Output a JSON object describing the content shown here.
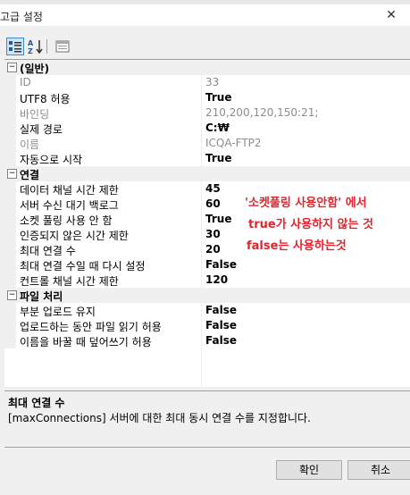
{
  "window": {
    "title": "고급 설정",
    "close_glyph": "✕"
  },
  "toolbar": {
    "categorized_icon": "categorized-view-icon",
    "alphabetical_icon": "alphabetical-sort-icon",
    "property_pages_icon": "property-pages-icon"
  },
  "grid": {
    "categories": [
      {
        "label": "(일반)",
        "toggle": "⊟",
        "properties": [
          {
            "name": "ID",
            "value": "33",
            "readonly": true
          },
          {
            "name": "UTF8 허용",
            "value": "True",
            "readonly": false
          },
          {
            "name": "바인딩",
            "value": "210,200,120,150:21;",
            "readonly": true
          },
          {
            "name": "실제 경로",
            "value": "C:₩",
            "readonly": false
          },
          {
            "name": "이름",
            "value": "ICQA-FTP2",
            "readonly": true
          },
          {
            "name": "자동으로 시작",
            "value": "True",
            "readonly": false
          }
        ]
      },
      {
        "label": "연결",
        "toggle": "⊟",
        "properties": [
          {
            "name": "데이터 채널 시간 제한",
            "value": "45",
            "readonly": false
          },
          {
            "name": "서버 수신 대기 백로그",
            "value": "60",
            "readonly": false
          },
          {
            "name": "소켓 풀링 사용 안 함",
            "value": "True",
            "readonly": false
          },
          {
            "name": "인증되지 않은 시간 제한",
            "value": "30",
            "readonly": false
          },
          {
            "name": "최대 연결 수",
            "value": "20",
            "readonly": false
          },
          {
            "name": "최대 연결 수일 때 다시 설정",
            "value": "False",
            "readonly": false
          },
          {
            "name": "컨트롤 채널 시간 제한",
            "value": "120",
            "readonly": false
          }
        ]
      },
      {
        "label": "파일 처리",
        "toggle": "⊟",
        "properties": [
          {
            "name": "부분 업로드 유지",
            "value": "False",
            "readonly": false
          },
          {
            "name": "업로드하는 동안 파일 읽기 허용",
            "value": "False",
            "readonly": false
          },
          {
            "name": "이름을 바꿀 때 덮어쓰기 허용",
            "value": "False",
            "readonly": false
          }
        ]
      }
    ]
  },
  "annotation": {
    "line1": "'소켓풀링 사용안함' 에서",
    "line2": "true가 사용하지 않는 것",
    "line3": "false는 사용하는것",
    "color": "#e4232c"
  },
  "help": {
    "title": "최대 연결 수",
    "description": "[maxConnections] 서버에 대한 최대 동시 연결 수를 지정합니다."
  },
  "buttons": {
    "ok": "확인",
    "cancel": "취소"
  }
}
